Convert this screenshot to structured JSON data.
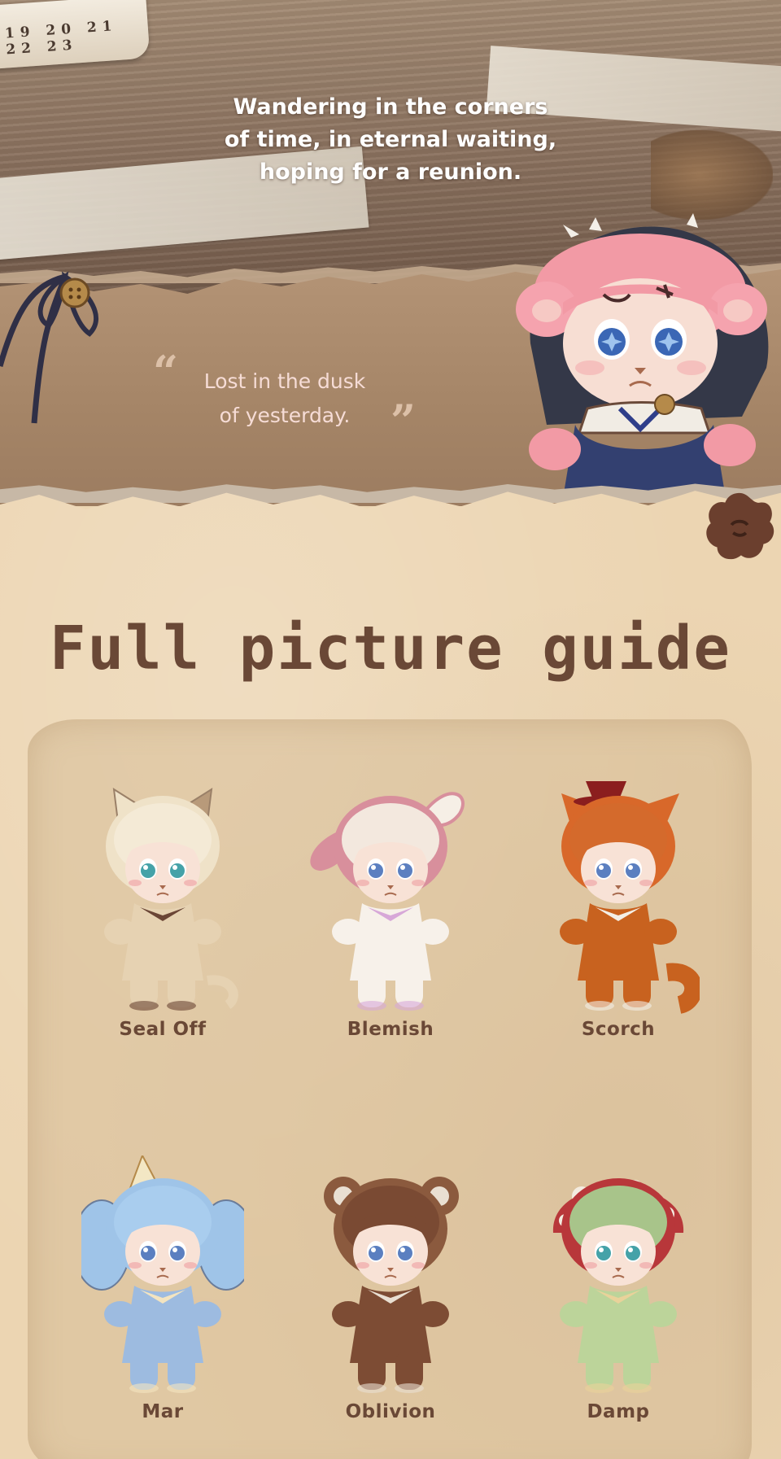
{
  "header": {
    "tagline_line1": "Wandering in the corners",
    "tagline_line2": "of time, in eternal waiting,",
    "tagline_line3": "hoping for a reunion.",
    "tape_numbers": "19 20 21 22 23"
  },
  "quote": {
    "open_mark": "“",
    "close_mark": "”",
    "line1": "Lost in the dusk",
    "line2": "of yesterday."
  },
  "guide": {
    "title": "Full picture guide",
    "characters": [
      {
        "name": "Seal Off",
        "hood": "#efe2c8",
        "hair": "#f4ead6",
        "body": "#e6d2b2",
        "accent": "#6b4636",
        "eye": "#45a2a8",
        "ears": "cat"
      },
      {
        "name": "Blemish",
        "hood": "#d88f9c",
        "hair": "#f3e8de",
        "body": "#f7f1ea",
        "accent": "#d7a8d8",
        "eye": "#5b7fc0",
        "ears": "bunny"
      },
      {
        "name": "Scorch",
        "hood": "#d8682a",
        "hair": "#d46a2c",
        "body": "#c8621f",
        "accent": "#f4efe6",
        "eye": "#5b7fc0",
        "ears": "fox"
      },
      {
        "name": "Mar",
        "hood": "#9fc4e8",
        "hair": "#a9cdee",
        "body": "#9dbbe0",
        "accent": "#f3e4c0",
        "eye": "#5b7fc0",
        "ears": "elephant"
      },
      {
        "name": "Oblivion",
        "hood": "#8b5a3e",
        "hair": "#7a4a33",
        "body": "#7d4c34",
        "accent": "#e9dfd2",
        "eye": "#5b7fc0",
        "ears": "bear"
      },
      {
        "name": "Damp",
        "hood": "#b8373a",
        "hair": "#a8c48a",
        "body": "#bcd49a",
        "accent": "#e9d29a",
        "eye": "#45a2a8",
        "ears": "mushroom"
      }
    ]
  },
  "icons": {
    "ribbon": "ribbon-bow-icon",
    "flower": "flower-button-icon"
  }
}
